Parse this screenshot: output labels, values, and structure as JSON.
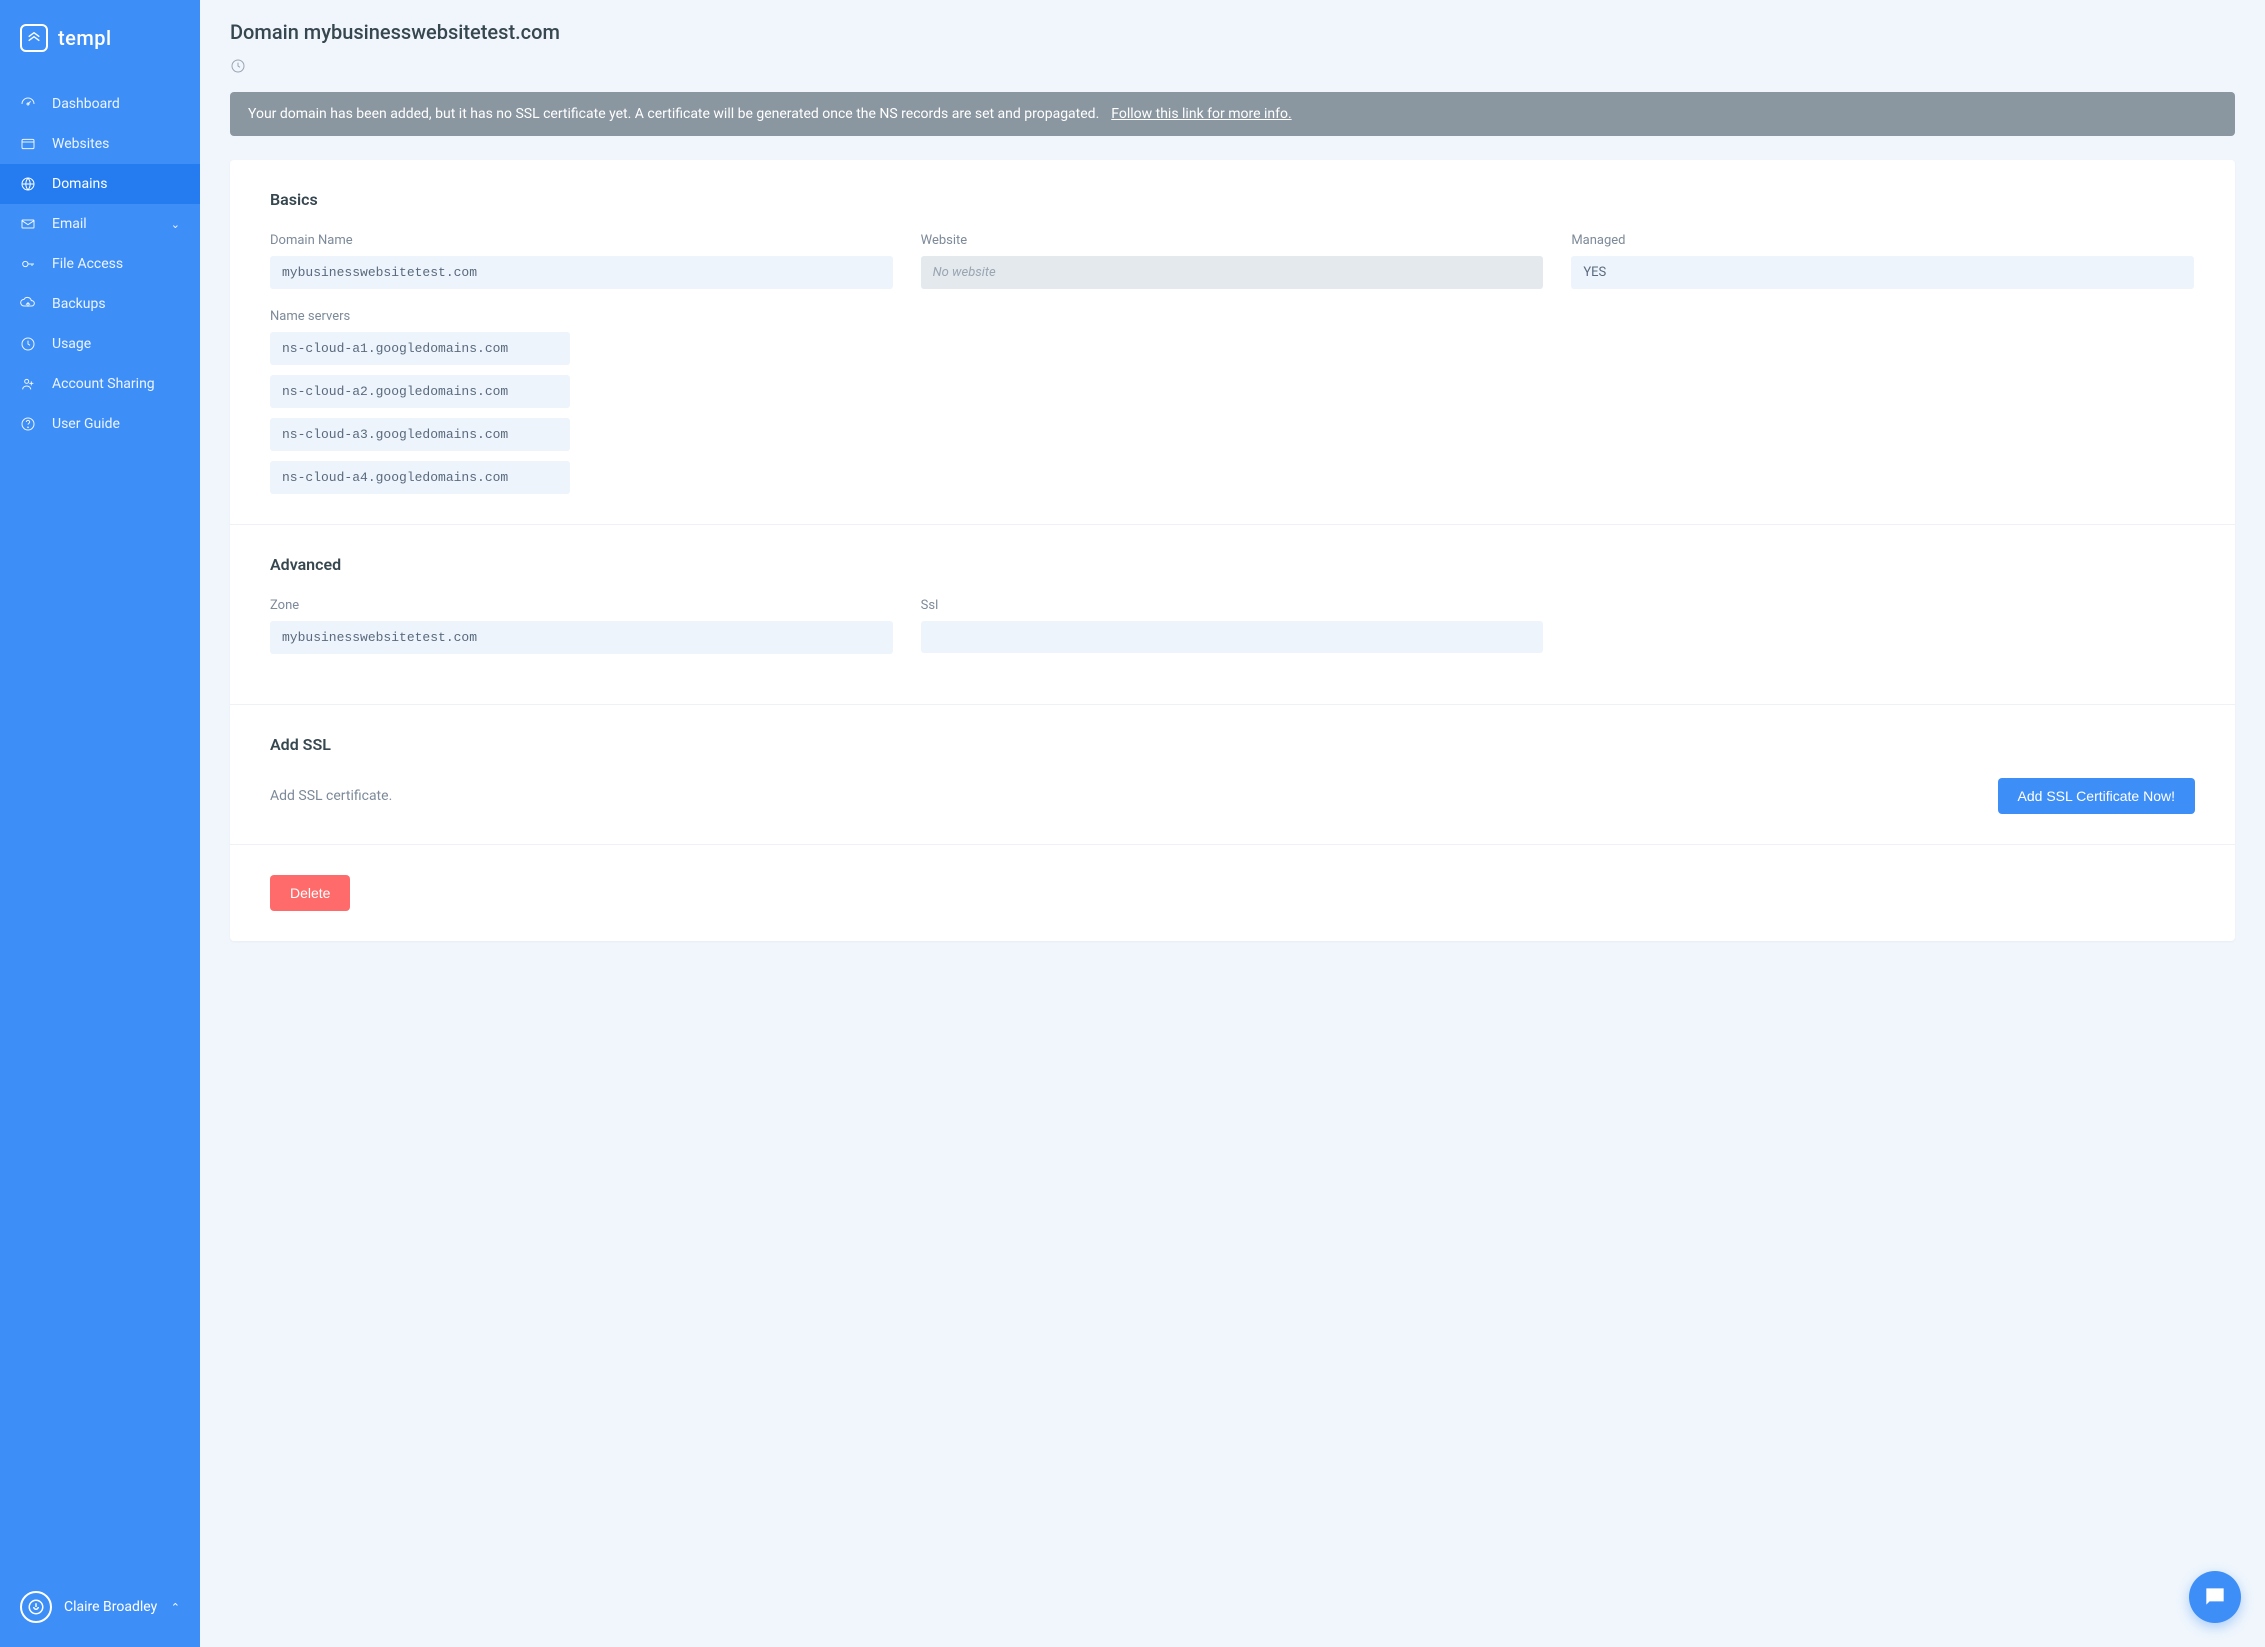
{
  "brand": "templ",
  "nav": [
    {
      "label": "Dashboard",
      "id": "dashboard",
      "icon": "dashboard"
    },
    {
      "label": "Websites",
      "id": "websites",
      "icon": "websites"
    },
    {
      "label": "Domains",
      "id": "domains",
      "icon": "domains",
      "active": true
    },
    {
      "label": "Email",
      "id": "email",
      "icon": "email",
      "expandable": true
    },
    {
      "label": "File Access",
      "id": "file-access",
      "icon": "key"
    },
    {
      "label": "Backups",
      "id": "backups",
      "icon": "backups"
    },
    {
      "label": "Usage",
      "id": "usage",
      "icon": "usage"
    },
    {
      "label": "Account Sharing",
      "id": "account-sharing",
      "icon": "share"
    },
    {
      "label": "User Guide",
      "id": "user-guide",
      "icon": "help"
    }
  ],
  "user": {
    "name": "Claire Broadley"
  },
  "page": {
    "title": "Domain mybusinesswebsitetest.com",
    "alert_text": "Your domain has been added, but it has no SSL certificate yet. A certificate will be generated once the NS records are set and propagated.",
    "alert_link_text": "Follow this link for more info."
  },
  "basics": {
    "title": "Basics",
    "domain_name_label": "Domain Name",
    "domain_name_value": "mybusinesswebsitetest.com",
    "website_label": "Website",
    "website_value": "No website",
    "managed_label": "Managed",
    "managed_value": "YES",
    "nameservers_label": "Name servers",
    "nameservers": [
      "ns-cloud-a1.googledomains.com",
      "ns-cloud-a2.googledomains.com",
      "ns-cloud-a3.googledomains.com",
      "ns-cloud-a4.googledomains.com"
    ]
  },
  "advanced": {
    "title": "Advanced",
    "zone_label": "Zone",
    "zone_value": "mybusinesswebsitetest.com",
    "ssl_label": "Ssl",
    "ssl_value": ""
  },
  "add_ssl": {
    "title": "Add SSL",
    "text": "Add SSL certificate.",
    "button": "Add SSL Certificate Now!"
  },
  "delete_button": "Delete"
}
